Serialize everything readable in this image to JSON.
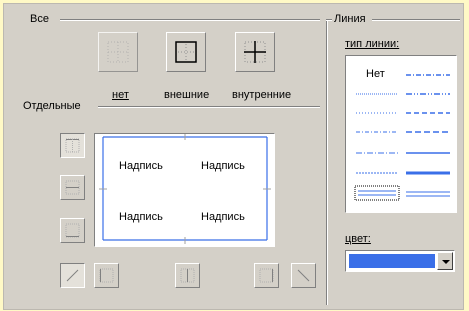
{
  "presets": {
    "group_label": "Все",
    "none_label": "нет",
    "outer_label": "внешние",
    "inner_label": "внутренние"
  },
  "individual": {
    "group_label": "Отдельные",
    "preview_text": [
      "Надпись",
      "Надпись",
      "Надпись",
      "Надпись"
    ]
  },
  "line": {
    "group_label": "Линия",
    "type_label": "тип линии:",
    "none_option": "Нет",
    "color_label": "цвет:",
    "color_value": "#3a6fe8"
  }
}
